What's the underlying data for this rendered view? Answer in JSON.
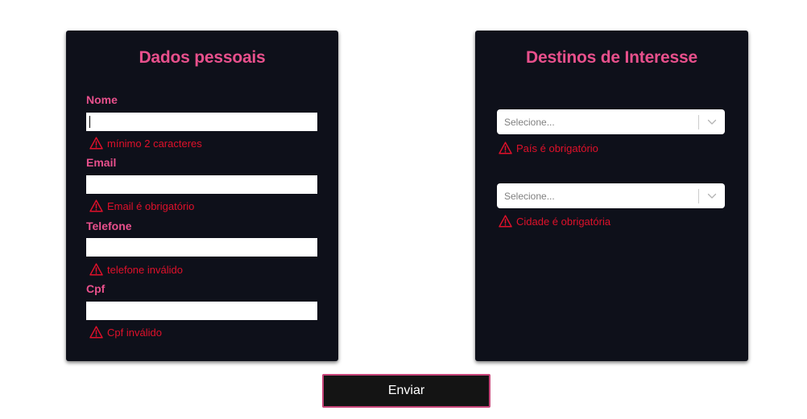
{
  "personal": {
    "title": "Dados pessoais",
    "fields": [
      {
        "label": "Nome",
        "value": "",
        "error": "mínimo 2 caracteres"
      },
      {
        "label": "Email",
        "value": "",
        "error": "Email é obrigatório"
      },
      {
        "label": "Telefone",
        "value": "",
        "error": "telefone inválido"
      },
      {
        "label": "Cpf",
        "value": "",
        "error": "Cpf inválido"
      }
    ]
  },
  "destinations": {
    "title": "Destinos de Interesse",
    "selects": [
      {
        "placeholder": "Selecione...",
        "error": "País é obrigatório"
      },
      {
        "placeholder": "Selecione...",
        "error": "Cidade é obrigatória"
      }
    ]
  },
  "submit_label": "Enviar",
  "icons": {
    "error": "warning-triangle-icon",
    "dropdown": "chevron-down-icon"
  },
  "colors": {
    "accent": "#e8508c",
    "error": "#e0102a",
    "card_bg": "#0e101a",
    "button_bg": "#141414",
    "button_border": "#c9457a"
  }
}
